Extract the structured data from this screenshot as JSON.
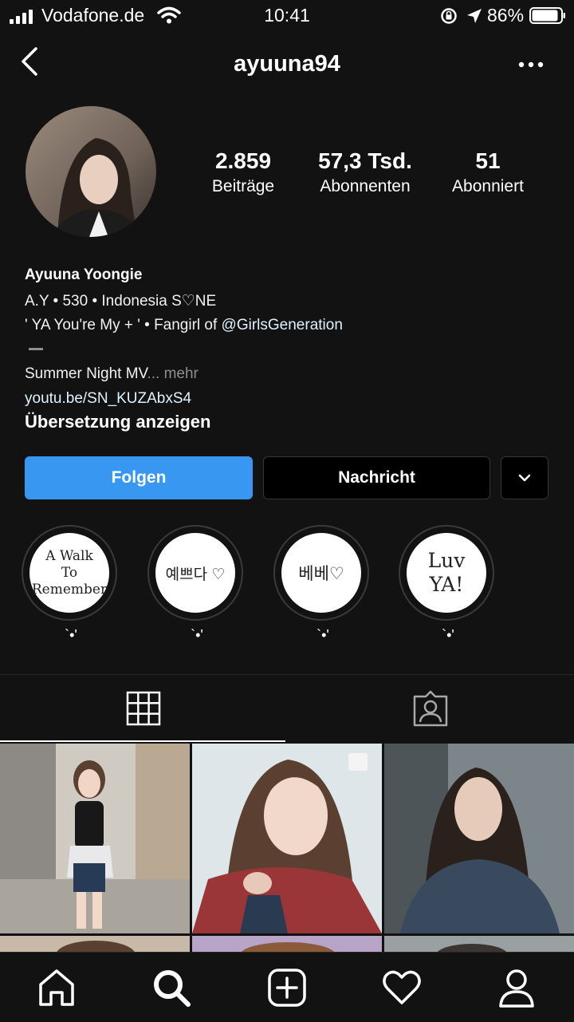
{
  "status_bar": {
    "carrier": "Vodafone.de",
    "time": "10:41",
    "battery": "86%"
  },
  "header": {
    "username": "ayuuna94"
  },
  "stats": [
    {
      "value": "2.859",
      "label": "Beiträge"
    },
    {
      "value": "57,3 Tsd.",
      "label": "Abonnenten"
    },
    {
      "value": "51",
      "label": "Abonniert"
    }
  ],
  "bio": {
    "name": "Ayuuna Yoongie",
    "line1": "A.Y • 530 • Indonesia S♡NE",
    "line2_prefix": "' YA You're My + ' • Fangirl of ",
    "line2_mention": "@GirlsGeneration",
    "line3": "Summer Night MV",
    "line3_ellipsis": "... ",
    "line3_more": "mehr",
    "link": "youtu.be/SN_KUZAbxS4",
    "translate": "Übersetzung anzeigen"
  },
  "actions": {
    "follow": "Folgen",
    "message": "Nachricht"
  },
  "highlights": [
    {
      "cover_lines": [
        "A Walk",
        "To",
        "Remember"
      ],
      "label": "`•'"
    },
    {
      "cover_lines": [
        "예쁘다 ♡"
      ],
      "label": "`•'"
    },
    {
      "cover_lines": [
        "베베♡"
      ],
      "label": "`•'"
    },
    {
      "cover_lines": [
        "Luv",
        "YA!"
      ],
      "label": "`•'"
    }
  ],
  "colors": {
    "accent": "#3897f0",
    "background": "#121212",
    "link": "#e0f1ff"
  },
  "icons": {
    "tabs": [
      "grid-icon",
      "tagged-person-icon"
    ],
    "bottom_nav": [
      "home-icon",
      "search-icon",
      "add-post-icon",
      "activity-heart-icon",
      "profile-icon"
    ]
  }
}
